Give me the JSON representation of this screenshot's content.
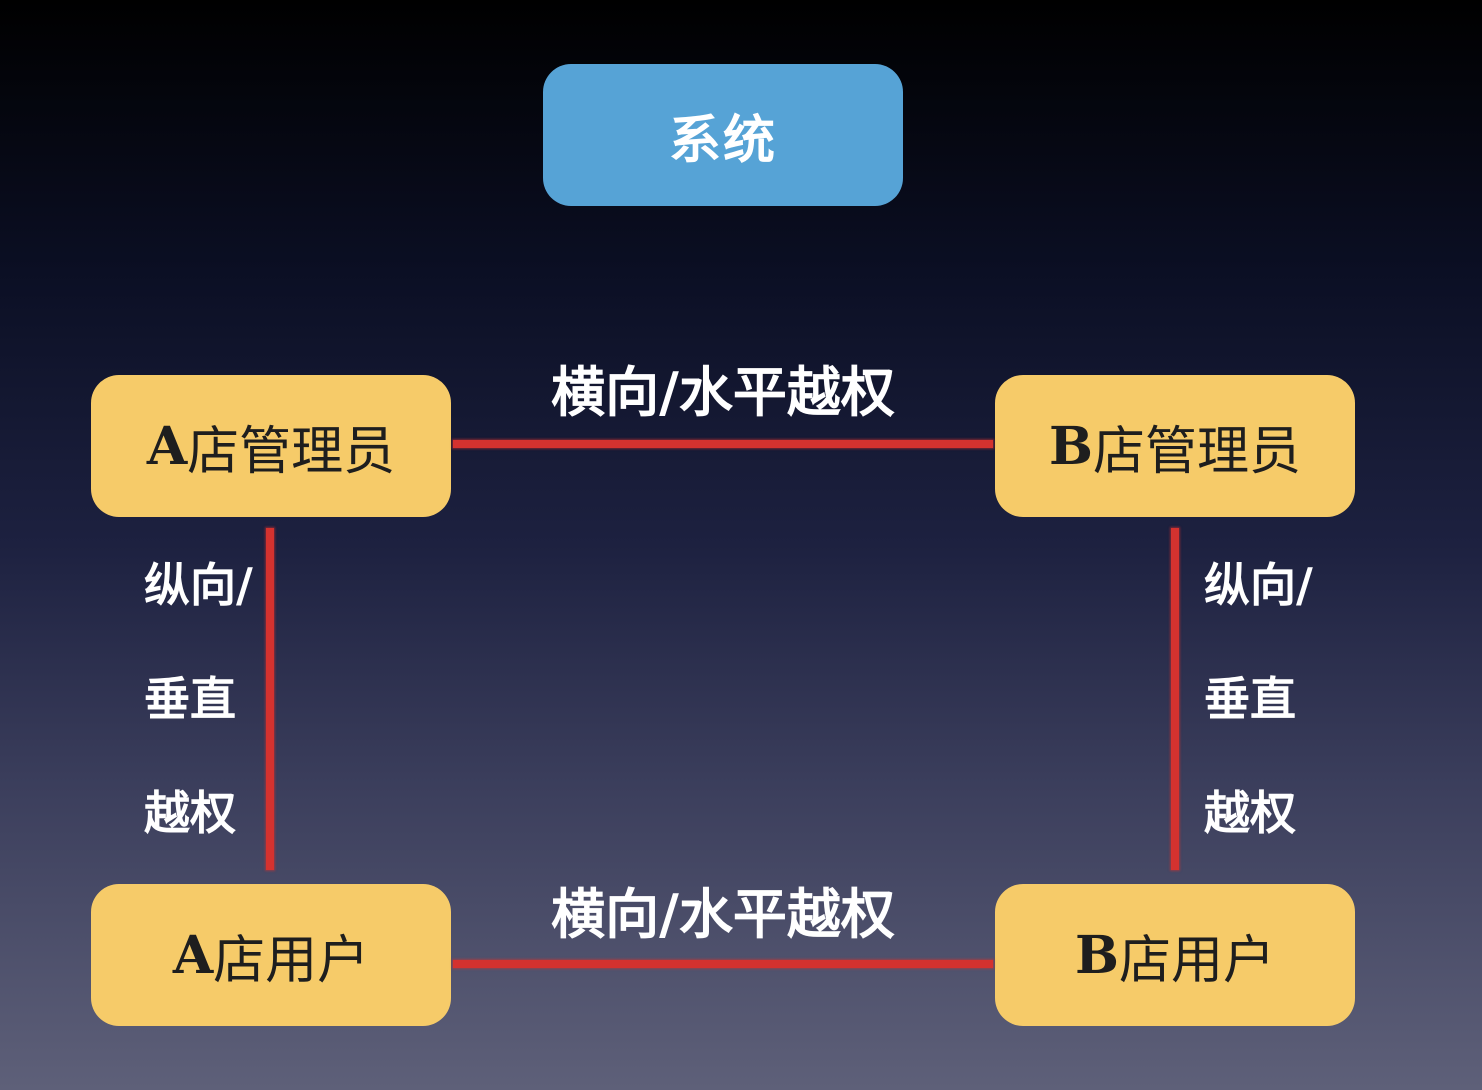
{
  "diagram": {
    "system": {
      "label": "系统"
    },
    "nodes": {
      "a_admin": {
        "prefix": "A",
        "label": "店管理员"
      },
      "b_admin": {
        "prefix": "B",
        "label": "店管理员"
      },
      "a_user": {
        "prefix": "A",
        "label": "店用户"
      },
      "b_user": {
        "prefix": "B",
        "label": "店用户"
      }
    },
    "edges": {
      "horizontal_top": {
        "label": "横向/水平越权"
      },
      "horizontal_bottom": {
        "label": "横向/水平越权"
      },
      "vertical_left": {
        "lines": [
          "纵向/",
          "垂直",
          "越权"
        ]
      },
      "vertical_right": {
        "lines": [
          "纵向/",
          "垂直",
          "越权"
        ]
      }
    },
    "colors": {
      "system_fill": "#56a3d6",
      "role_fill": "#f6cb69",
      "connector": "#d4322f",
      "label_text": "#ffffff"
    }
  }
}
